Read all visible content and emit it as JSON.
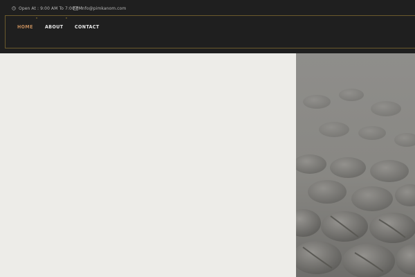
{
  "topbar": {
    "hours": "Open At : 9:00 AM To 7:00 PM",
    "email": "info@pimkanom.com",
    "icons": [
      "clock-icon",
      "mail-icon"
    ]
  },
  "nav": {
    "items": [
      {
        "label": "HOME",
        "active": true
      },
      {
        "label": "ABOUT",
        "active": false
      },
      {
        "label": "CONTACT",
        "active": false
      }
    ]
  },
  "colors": {
    "accent": "#c08a5a",
    "dark_bg": "#1f1f1f",
    "border_gold": "#6b5a2d",
    "hero_light": "#edece8",
    "hero_image_gray": "#8f8e8b"
  },
  "hero_image": {
    "subject": "coffee-beans-image"
  }
}
